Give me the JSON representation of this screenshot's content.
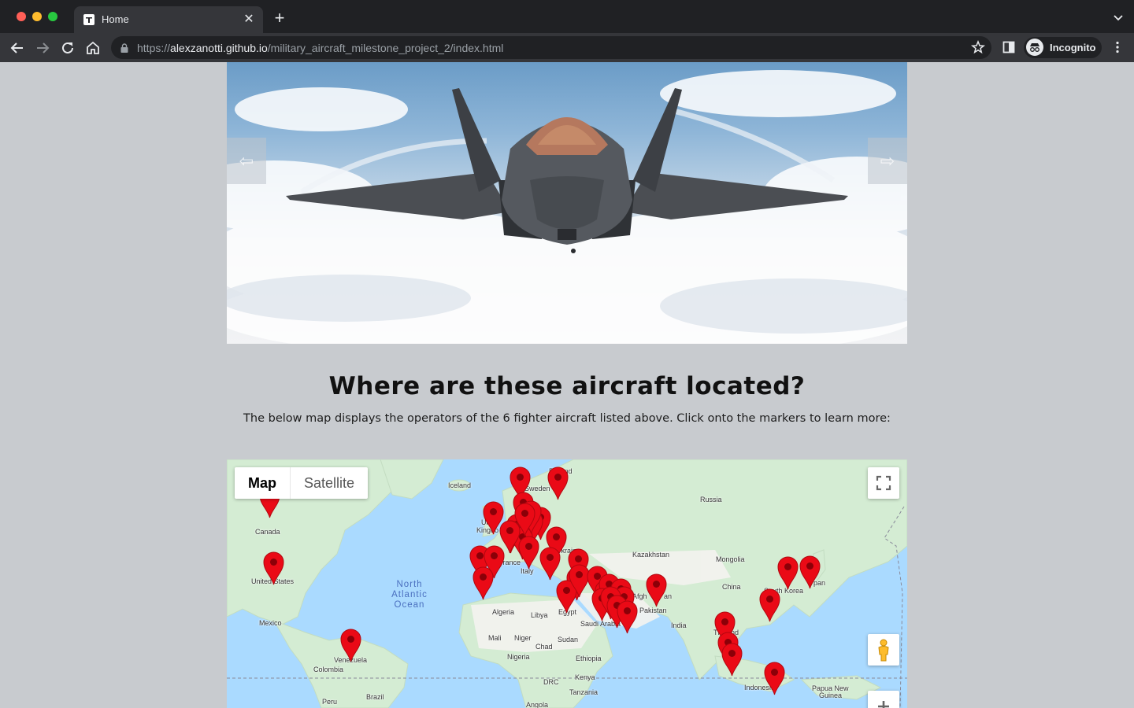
{
  "browser": {
    "tab_title": "Home",
    "url_scheme": "https://",
    "url_host": "alexzanotti.github.io",
    "url_path": "/military_aircraft_milestone_project_2/index.html",
    "profile_label": "Incognito"
  },
  "carousel": {
    "prev_icon": "⇦",
    "next_icon": "⇨"
  },
  "section": {
    "title": "Where are these aircraft located?",
    "description": "The below map displays the operators of the 6 fighter aircraft listed above. Click onto the markers to learn more:"
  },
  "map": {
    "type_buttons": {
      "map": "Map",
      "satellite": "Satellite"
    },
    "ocean_label": [
      "North",
      "Atlantic",
      "Ocean"
    ],
    "place_labels": {
      "finland": "Finland",
      "sweden": "Sweden",
      "iceland": "Iceland",
      "russia": "Russia",
      "united_kingdom_1": "Un",
      "united_kingdom_2": "Kingdo",
      "canada": "Canada",
      "ukraine": "Ukraine",
      "kazakhstan": "Kazakhstan",
      "mongolia": "Mongolia",
      "france": "France",
      "spain": "in",
      "italy": "Italy",
      "united_states": "United States",
      "china": "China",
      "south_korea": "South Korea",
      "japan": "pan",
      "afghanistan": "Afgh",
      "afghanistan_end": "an",
      "pakistan": "Pakistan",
      "algeria": "Algeria",
      "libya": "Libya",
      "egypt": "Egypt",
      "saudi_arabia": "Saudi Arabia",
      "mexico": "Mexico",
      "india": "India",
      "thailand_1": "Th",
      "thailand_2": "nd",
      "mali": "Mali",
      "niger": "Niger",
      "sudan": "Sudan",
      "chad": "Chad",
      "venezuela": "Venezuela",
      "nigeria": "Nigeria",
      "ethiopia": "Ethiopia",
      "colombia": "Colombia",
      "kenya": "Kenya",
      "drc": "DRC",
      "indonesia": "Indonesia",
      "papua_new_guinea_1": "Papua New",
      "papua_new_guinea_2": "Guinea",
      "tanzania": "Tanzania",
      "peru": "Peru",
      "brazil": "Brazil",
      "angola": "Angola"
    },
    "marker_count": 42,
    "colors": {
      "marker": "#ea0a16",
      "water": "#aadaff",
      "land": "#d4ecd3"
    }
  }
}
